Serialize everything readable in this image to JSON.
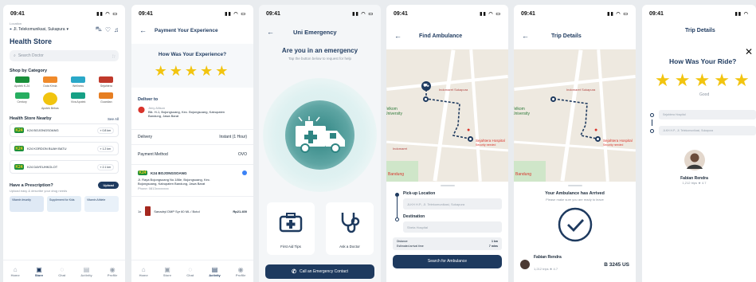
{
  "time": "09:41",
  "s1": {
    "location_label": "Location",
    "location": "Jl. Telekomunikasi, Sukapura",
    "title": "Health Store",
    "search_ph": "Search Doctor",
    "shop_by_category": "Shop by Category",
    "categories": [
      {
        "label": "Apotek K-24",
        "color": "#1a8f3a"
      },
      {
        "label": "Duta Kimia",
        "color": "#f08a2a"
      },
      {
        "label": "Wellness",
        "color": "#2aa8c8"
      },
      {
        "label": "Sejahtera",
        "color": "#c0392b"
      },
      {
        "label": "Century",
        "color": "#27ae60"
      },
      {
        "label": "Apotek Bebas",
        "color": "#f1c40f"
      },
      {
        "label": "Viva Apotek",
        "color": "#16a085"
      },
      {
        "label": "Guardian",
        "color": "#e67e22"
      }
    ],
    "nearby_title": "Health Store Nearby",
    "see_all": "See All",
    "stores": [
      {
        "name": "K24 BOJONGSOANG",
        "dist": "0.8 km"
      },
      {
        "name": "K24 KORDON BUAH BATU",
        "dist": "1.2 km"
      },
      {
        "name": "K24 DAYEUHKOLOT",
        "dist": "2.1 km"
      }
    ],
    "prescription_title": "Have a Prescription?",
    "prescription_sub": "Upload easy & describe your drug needs",
    "upload": "Upload",
    "promos": [
      "Vitamin Imunity",
      "Supplement for Kids",
      "Vitamin Athlete"
    ]
  },
  "nav": [
    "Home",
    "Store",
    "Chat",
    "Activity",
    "Profile"
  ],
  "s2": {
    "title": "Payment Your Experience",
    "question": "How Was Your Experience?",
    "deliver_to": "Deliver to",
    "addr_name": "Jeny Allison",
    "addr": "Blk. H-1, Bojongsoang, Kec. Bojongsoang, Kabupaten Bandung, Jawa Barat",
    "delivery_label": "Delivery",
    "delivery_val": "Instant (1 Hour)",
    "payment_label": "Payment Method",
    "payment_val": "OVO",
    "store_name": "K24 BOJONGSOANG",
    "store_addr": "Jl. Raya Bojongsoang No.186e, Bojongsoang, Kec. Bojongsoang, Kabupaten Bandung, Jawa Barat",
    "store_phone": "Phone: 0813xxxxxxxx",
    "qty": "1x",
    "product": "Sanadryl DMP Syr 60 ML / Botol",
    "price": "Rp21.400"
  },
  "s3": {
    "title": "Uni Emergency",
    "heading": "Are you in an emergency",
    "sub": "Tap the button below to request for help",
    "first_aid": "First Aid Tips",
    "ask_doctor": "Ask a Doctor",
    "call": "Call an Emergency Contact"
  },
  "s4": {
    "title": "Find Ambulance",
    "place1": "Indomaret Sukapura",
    "place2": "Sejahtera Hospital",
    "place2_sub": "Security needed",
    "place3": "Indomaret",
    "label_bandung": "Bandung",
    "label_university": "Telkom University",
    "pickup_label": "Pick-up Location",
    "pickup_val": "JLKH H.P., Jl. Telekomunikasi, Sukapura",
    "dest_label": "Destination",
    "dest_val": "Sheta Hospital",
    "distance_label": "Distance",
    "distance_val": "1 km",
    "eta_label": "Estimated arrival time",
    "eta_val": "7 mins",
    "cta": "Search for Ambulance"
  },
  "s5": {
    "title": "Trip Details",
    "arrived": "Your Ambulance has Arrived",
    "arrived_sub": "Please make sure you are ready to leave",
    "driver": "Fabian Rendra",
    "driver_sub": "1,212 trips ★ 4.7",
    "plate": "B 3245 US"
  },
  "s6": {
    "title": "Trip Details",
    "question": "How Was Your Ride?",
    "rating_word": "Good",
    "from": "Sejahtera Hospital",
    "to": "JLKH H.P., Jl. Telekomunikasi, Sukapura",
    "driver": "Fabian Rendra",
    "driver_sub": "1,212 trips ★ 4.7"
  }
}
